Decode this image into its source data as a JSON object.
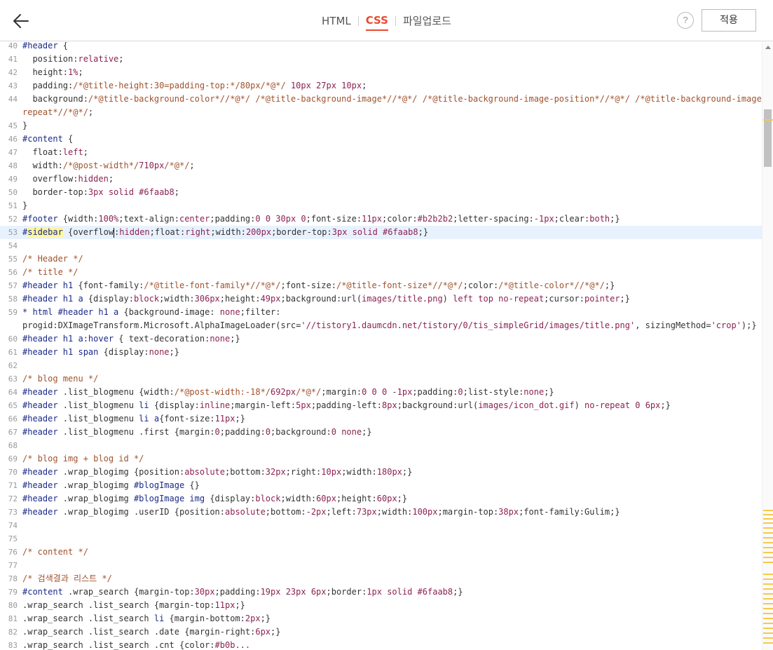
{
  "header": {
    "tabs": [
      {
        "label": "HTML",
        "active": false
      },
      {
        "label": "CSS",
        "active": true
      },
      {
        "label": "파일업로드",
        "active": false
      }
    ],
    "help_label": "?",
    "apply_label": "적용"
  },
  "editor": {
    "active_line": "53",
    "lines": [
      {
        "n": "40",
        "t": [
          [
            "#header",
            "sel"
          ],
          [
            " {",
            ""
          ]
        ]
      },
      {
        "n": "41",
        "t": [
          [
            "  position:",
            "pr"
          ],
          [
            "relative",
            "val"
          ],
          [
            ";",
            ""
          ]
        ]
      },
      {
        "n": "42",
        "t": [
          [
            "  height:",
            "pr"
          ],
          [
            "1%",
            "val"
          ],
          [
            ";",
            ""
          ]
        ]
      },
      {
        "n": "43",
        "t": [
          [
            "  padding:",
            "pr"
          ],
          [
            "/*@title-height:30=padding-top:*/80px/*@*/",
            "cm"
          ],
          [
            " 10px 27px 10px",
            "val"
          ],
          [
            ";",
            ""
          ]
        ]
      },
      {
        "n": "44",
        "t": [
          [
            "  background:",
            "pr"
          ],
          [
            "/*@title-background-color*//*@*/ /*@title-background-image*//*@*/ /*@title-background-image-position*//*@*/ /*@title-background-image-",
            "cm"
          ]
        ]
      },
      {
        "n": "",
        "t": [
          [
            "repeat*//*@*/",
            "cm"
          ],
          [
            ";",
            ""
          ]
        ]
      },
      {
        "n": "45",
        "t": [
          [
            "}",
            ""
          ]
        ]
      },
      {
        "n": "46",
        "t": [
          [
            "#content",
            "sel"
          ],
          [
            " {",
            ""
          ]
        ]
      },
      {
        "n": "47",
        "t": [
          [
            "  float:",
            "pr"
          ],
          [
            "left",
            "val"
          ],
          [
            ";",
            ""
          ]
        ]
      },
      {
        "n": "48",
        "t": [
          [
            "  width:",
            "pr"
          ],
          [
            "/*@post-width*/",
            "cm"
          ],
          [
            "710px",
            "val"
          ],
          [
            "/*@*/",
            "cm"
          ],
          [
            ";",
            ""
          ]
        ]
      },
      {
        "n": "49",
        "t": [
          [
            "  overflow:",
            "pr"
          ],
          [
            "hidden",
            "val"
          ],
          [
            ";",
            ""
          ]
        ]
      },
      {
        "n": "50",
        "t": [
          [
            "  border-top:",
            "pr"
          ],
          [
            "3px solid #6faab8",
            "val"
          ],
          [
            ";",
            ""
          ]
        ]
      },
      {
        "n": "51",
        "t": [
          [
            "}",
            ""
          ]
        ]
      },
      {
        "n": "52",
        "t": [
          [
            "#footer",
            "sel"
          ],
          [
            " {width:",
            ""
          ],
          [
            "100%",
            "val"
          ],
          [
            ";text-align:",
            ""
          ],
          [
            "center",
            "val"
          ],
          [
            ";padding:",
            ""
          ],
          [
            "0 0 30px 0",
            "val"
          ],
          [
            ";font-size:",
            ""
          ],
          [
            "11px",
            "val"
          ],
          [
            ";color:",
            ""
          ],
          [
            "#b2b2b2",
            "val"
          ],
          [
            ";letter-spacing:",
            ""
          ],
          [
            "-1px",
            "val"
          ],
          [
            ";clear:",
            ""
          ],
          [
            "both",
            "val"
          ],
          [
            ";}",
            ""
          ]
        ]
      },
      {
        "n": "53",
        "t": [
          [
            "#",
            "sel"
          ],
          [
            "sidebar",
            "sel hl"
          ],
          [
            " {overflow",
            ""
          ],
          [
            "|",
            "cursor"
          ],
          [
            ":",
            ""
          ],
          [
            "hidden",
            "val"
          ],
          [
            ";float:",
            ""
          ],
          [
            "right",
            "val"
          ],
          [
            ";width:",
            ""
          ],
          [
            "200px",
            "val"
          ],
          [
            ";border-top:",
            ""
          ],
          [
            "3px solid #6faab8",
            "val"
          ],
          [
            ";}",
            ""
          ]
        ]
      },
      {
        "n": "54",
        "t": []
      },
      {
        "n": "55",
        "t": [
          [
            "/* Header */",
            "cm"
          ]
        ]
      },
      {
        "n": "56",
        "t": [
          [
            "/* title */",
            "cm"
          ]
        ]
      },
      {
        "n": "57",
        "t": [
          [
            "#header h1",
            "sel"
          ],
          [
            " {font-family:",
            ""
          ],
          [
            "/*@title-font-family*//*@*/",
            "cm"
          ],
          [
            ";font-size:",
            ""
          ],
          [
            "/*@title-font-size*//*@*/",
            "cm"
          ],
          [
            ";color:",
            ""
          ],
          [
            "/*@title-color*//*@*/",
            "cm"
          ],
          [
            ";}",
            ""
          ]
        ]
      },
      {
        "n": "58",
        "t": [
          [
            "#header h1 a",
            "sel"
          ],
          [
            " {display:",
            ""
          ],
          [
            "block",
            "val"
          ],
          [
            ";width:",
            ""
          ],
          [
            "306px",
            "val"
          ],
          [
            ";height:",
            ""
          ],
          [
            "49px",
            "val"
          ],
          [
            ";background:url(",
            ""
          ],
          [
            "images/title.png",
            "val"
          ],
          [
            ") ",
            ""
          ],
          [
            "left top no-repeat",
            "val"
          ],
          [
            ";cursor:",
            ""
          ],
          [
            "pointer",
            "val"
          ],
          [
            ";}",
            ""
          ]
        ]
      },
      {
        "n": "59",
        "t": [
          [
            "* html #header h1 a",
            "sel"
          ],
          [
            " {background-image: ",
            ""
          ],
          [
            "none",
            "val"
          ],
          [
            ";filter:",
            ""
          ]
        ]
      },
      {
        "n": "",
        "t": [
          [
            "progid:DXImageTransform.Microsoft.AlphaImageLoader(src=",
            ""
          ],
          [
            "'//tistory1.daumcdn.net/tistory/0/tis_simpleGrid/images/title.png'",
            "val"
          ],
          [
            ", sizingMethod=",
            ""
          ],
          [
            "'crop'",
            "val"
          ],
          [
            ");}",
            ""
          ]
        ]
      },
      {
        "n": "60",
        "t": [
          [
            "#header h1 a:hover",
            "sel"
          ],
          [
            " { text-decoration:",
            ""
          ],
          [
            "none",
            "val"
          ],
          [
            ";}",
            ""
          ]
        ]
      },
      {
        "n": "61",
        "t": [
          [
            "#header h1 span",
            "sel"
          ],
          [
            " {display:",
            ""
          ],
          [
            "none",
            "val"
          ],
          [
            ";}",
            ""
          ]
        ]
      },
      {
        "n": "62",
        "t": []
      },
      {
        "n": "63",
        "t": [
          [
            "/* blog menu */",
            "cm"
          ]
        ]
      },
      {
        "n": "64",
        "t": [
          [
            "#header",
            "sel"
          ],
          [
            " .list_blogmenu {width:",
            ""
          ],
          [
            "/*@post-width:-18*/",
            "cm"
          ],
          [
            "692px",
            "val"
          ],
          [
            "/*@*/",
            "cm"
          ],
          [
            ";margin:",
            ""
          ],
          [
            "0 0 0 -1px",
            "val"
          ],
          [
            ";padding:",
            ""
          ],
          [
            "0",
            "val"
          ],
          [
            ";list-style:",
            ""
          ],
          [
            "none",
            "val"
          ],
          [
            ";}",
            ""
          ]
        ]
      },
      {
        "n": "65",
        "t": [
          [
            "#header",
            "sel"
          ],
          [
            " .list_blogmenu ",
            ""
          ],
          [
            "li",
            "sel"
          ],
          [
            " {display:",
            ""
          ],
          [
            "inline",
            "val"
          ],
          [
            ";margin-left:",
            ""
          ],
          [
            "5px",
            "val"
          ],
          [
            ";padding-left:",
            ""
          ],
          [
            "8px",
            "val"
          ],
          [
            ";background:url(",
            ""
          ],
          [
            "images/icon_dot.gif",
            "val"
          ],
          [
            ") ",
            ""
          ],
          [
            "no-repeat 0 6px",
            "val"
          ],
          [
            ";}",
            ""
          ]
        ]
      },
      {
        "n": "66",
        "t": [
          [
            "#header",
            "sel"
          ],
          [
            " .list_blogmenu ",
            ""
          ],
          [
            "li a",
            "sel"
          ],
          [
            "{font-size:",
            ""
          ],
          [
            "11px",
            "val"
          ],
          [
            ";}",
            ""
          ]
        ]
      },
      {
        "n": "67",
        "t": [
          [
            "#header",
            "sel"
          ],
          [
            " .list_blogmenu .first {margin:",
            ""
          ],
          [
            "0",
            "val"
          ],
          [
            ";padding:",
            ""
          ],
          [
            "0",
            "val"
          ],
          [
            ";background:",
            ""
          ],
          [
            "0 none",
            "val"
          ],
          [
            ";}",
            ""
          ]
        ]
      },
      {
        "n": "68",
        "t": []
      },
      {
        "n": "69",
        "t": [
          [
            "/* blog img + blog id */",
            "cm"
          ]
        ]
      },
      {
        "n": "70",
        "t": [
          [
            "#header",
            "sel"
          ],
          [
            " .wrap_blogimg {position:",
            ""
          ],
          [
            "absolute",
            "val"
          ],
          [
            ";bottom:",
            ""
          ],
          [
            "32px",
            "val"
          ],
          [
            ";right:",
            ""
          ],
          [
            "10px",
            "val"
          ],
          [
            ";width:",
            ""
          ],
          [
            "180px",
            "val"
          ],
          [
            ";}",
            ""
          ]
        ]
      },
      {
        "n": "71",
        "t": [
          [
            "#header",
            "sel"
          ],
          [
            " .wrap_blogimg ",
            ""
          ],
          [
            "#blogImage",
            "sel"
          ],
          [
            " {}",
            ""
          ]
        ]
      },
      {
        "n": "72",
        "t": [
          [
            "#header",
            "sel"
          ],
          [
            " .wrap_blogimg ",
            ""
          ],
          [
            "#blogImage img",
            "sel"
          ],
          [
            " {display:",
            ""
          ],
          [
            "block",
            "val"
          ],
          [
            ";width:",
            ""
          ],
          [
            "60px",
            "val"
          ],
          [
            ";height:",
            ""
          ],
          [
            "60px",
            "val"
          ],
          [
            ";}",
            ""
          ]
        ]
      },
      {
        "n": "73",
        "t": [
          [
            "#header",
            "sel"
          ],
          [
            " .wrap_blogimg .userID {position:",
            ""
          ],
          [
            "absolute",
            "val"
          ],
          [
            ";bottom:",
            ""
          ],
          [
            "-2px",
            "val"
          ],
          [
            ";left:",
            ""
          ],
          [
            "73px",
            "val"
          ],
          [
            ";width:",
            ""
          ],
          [
            "100px",
            "val"
          ],
          [
            ";margin-top:",
            ""
          ],
          [
            "38px",
            "val"
          ],
          [
            ";font-family:Gulim;}",
            ""
          ]
        ]
      },
      {
        "n": "74",
        "t": []
      },
      {
        "n": "75",
        "t": []
      },
      {
        "n": "76",
        "t": [
          [
            "/* content */",
            "cm"
          ]
        ]
      },
      {
        "n": "77",
        "t": []
      },
      {
        "n": "78",
        "t": [
          [
            "/* 검색결과 리스트 */",
            "cm"
          ]
        ]
      },
      {
        "n": "79",
        "t": [
          [
            "#content",
            "sel"
          ],
          [
            " .wrap_search {margin-top:",
            ""
          ],
          [
            "30px",
            "val"
          ],
          [
            ";padding:",
            ""
          ],
          [
            "19px 23px 6px",
            "val"
          ],
          [
            ";border:",
            ""
          ],
          [
            "1px solid #6faab8",
            "val"
          ],
          [
            ";}",
            ""
          ]
        ]
      },
      {
        "n": "80",
        "t": [
          [
            ".wrap_search .list_search {margin-top:",
            ""
          ],
          [
            "11px",
            "val"
          ],
          [
            ";}",
            ""
          ]
        ]
      },
      {
        "n": "81",
        "t": [
          [
            ".wrap_search .list_search ",
            ""
          ],
          [
            "li",
            "sel"
          ],
          [
            " {margin-bottom:",
            ""
          ],
          [
            "2px",
            "val"
          ],
          [
            ";}",
            ""
          ]
        ]
      },
      {
        "n": "82",
        "t": [
          [
            ".wrap_search .list_search .date {margin-right:",
            ""
          ],
          [
            "6px",
            "val"
          ],
          [
            ";}",
            ""
          ]
        ]
      },
      {
        "n": "83",
        "t": [
          [
            ".wrap_search .list_search .cnt {color:",
            ""
          ],
          [
            "#b0b...",
            "val"
          ]
        ]
      }
    ]
  }
}
